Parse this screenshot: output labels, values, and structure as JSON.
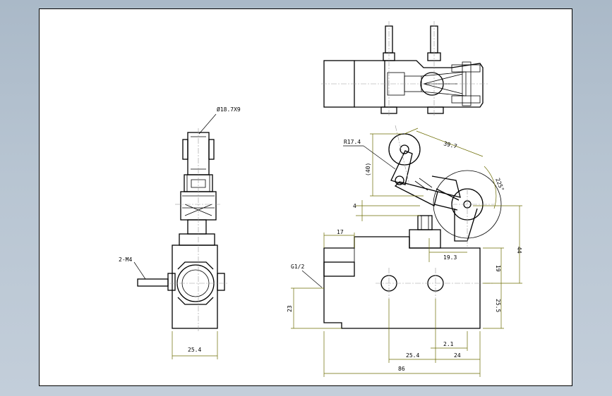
{
  "drawing": {
    "dimensions": {
      "roller_callout": "Ø18.7X9",
      "thread_callout": "2-M4",
      "width_side": "25.4",
      "radius_callout": "R17.4",
      "arm_length": "39.7",
      "paren_40": "(40)",
      "angle": "225°",
      "offset_4": "4",
      "top_17": "17",
      "port_callout": "G1/2",
      "right_19_3": "19.3",
      "right_44": "44",
      "right_19": "19",
      "right_25_5": "25.5",
      "left_23": "23",
      "bottom_2_1": "2.1",
      "bottom_25_4": "25.4",
      "bottom_24": "24",
      "bottom_86": "86"
    }
  }
}
